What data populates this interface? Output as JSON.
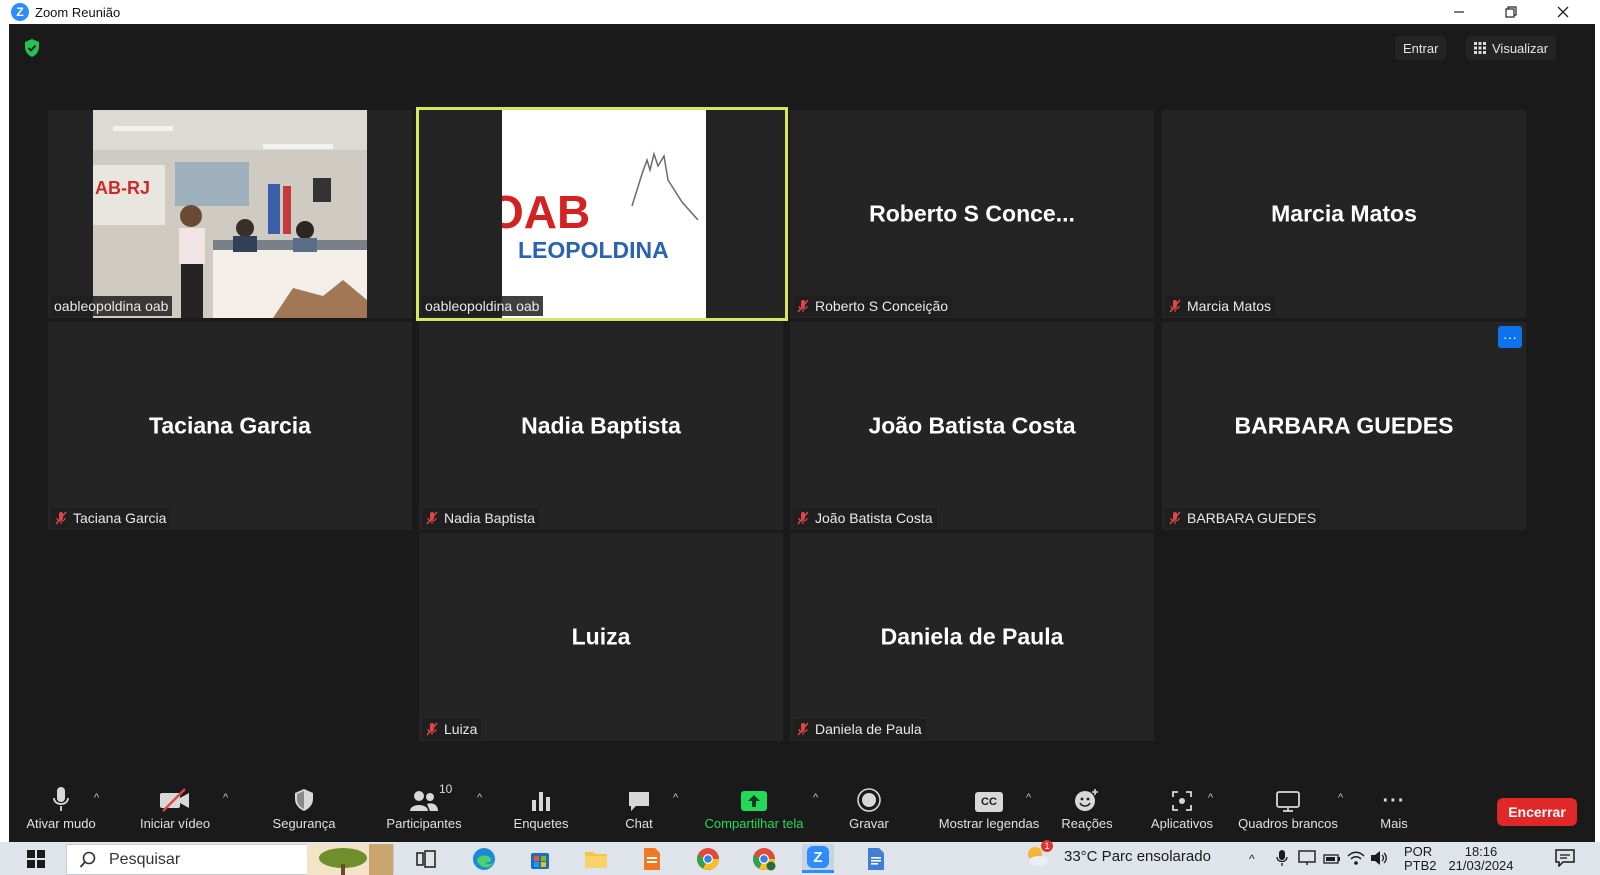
{
  "window": {
    "title": "Zoom Reunião",
    "app_icon": "Z"
  },
  "top_buttons": {
    "enter": "Entrar",
    "view": "Visualizar"
  },
  "participants": [
    {
      "label": "oableopoldina oab",
      "type": "video-room"
    },
    {
      "label": "oableopoldina oab",
      "type": "video-logo",
      "active_speaker": true
    },
    {
      "label": "Roberto S Conceição",
      "display_name": "Roberto S Conce...",
      "muted": true
    },
    {
      "label": "Marcia Matos",
      "display_name": "Marcia Matos",
      "muted": true
    },
    {
      "label": "Taciana Garcia",
      "display_name": "Taciana Garcia",
      "muted": true
    },
    {
      "label": "Nadia Baptista",
      "display_name": "Nadia Baptista",
      "muted": true
    },
    {
      "label": "João Batista Costa",
      "display_name": "João Batista Costa",
      "muted": true
    },
    {
      "label": "BARBARA GUEDES",
      "display_name": "BARBARA GUEDES",
      "muted": true
    },
    {
      "label": "Luiza",
      "display_name": "Luiza",
      "muted": true
    },
    {
      "label": "Daniela de Paula",
      "display_name": "Daniela de Paula",
      "muted": true
    }
  ],
  "video_content": {
    "room_sign": "AB-RJ",
    "logo_main": "OAB",
    "logo_sub": "LEOPOLDINA"
  },
  "tile_menu": "···",
  "toolbar": {
    "unmute": "Ativar mudo",
    "start_video": "Iniciar vídeo",
    "security": "Segurança",
    "participants": "Participantes",
    "participants_count": "10",
    "polls": "Enquetes",
    "chat": "Chat",
    "share_screen": "Compartilhar tela",
    "record": "Gravar",
    "captions": "Mostrar legendas",
    "captions_icon_text": "CC",
    "reactions": "Reações",
    "apps": "Aplicativos",
    "whiteboards": "Quadros brancos",
    "more": "Mais",
    "more_icon_text": "···",
    "end": "Encerrar"
  },
  "colors": {
    "meeting_bg": "#1a1a1a",
    "tile_bg": "#242424",
    "active_border": "#d8e85e",
    "share_green": "#23d959",
    "end_red": "#e02828",
    "zoom_blue": "#2d8cff"
  },
  "taskbar": {
    "search_placeholder": "Pesquisar",
    "weather": "33°C  Parc ensolarado",
    "weather_badge": "1",
    "lang": "POR",
    "lang_sub": "PTB2",
    "time": "18:16",
    "date": "21/03/2024"
  }
}
